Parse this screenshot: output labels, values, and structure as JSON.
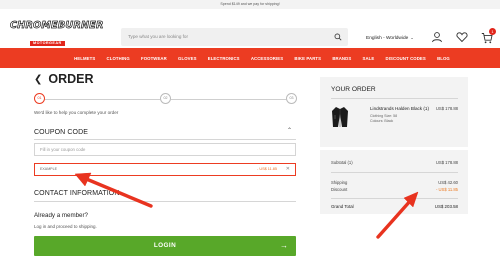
{
  "topbar": {
    "text": "Spend $149 and we pay for shipping!"
  },
  "header": {
    "logo_main": "CHROMEBURNER",
    "logo_sub": "MOTORGEAR",
    "search_placeholder": "Type what you are looking for",
    "locale": "English - Worldwide",
    "cart_count": "1",
    "icons": [
      "search-icon",
      "user-icon",
      "heart-icon",
      "cart-icon"
    ]
  },
  "nav": {
    "items": [
      "HELMETS",
      "CLOTHING",
      "FOOTWEAR",
      "GLOVES",
      "ELECTRONICS",
      "ACCESSORIES",
      "BIKE PARTS",
      "BRANDS",
      "SALE",
      "DISCOUNT CODES",
      "BLOG"
    ]
  },
  "checkout": {
    "title": "ORDER",
    "steps": [
      "01",
      "02",
      "03"
    ],
    "active_step": 1,
    "welcome": "We'd like to help you complete your order",
    "coupon_heading": "COUPON CODE",
    "coupon_placeholder": "Fill in your coupon code",
    "applied_code": "EXAMPLE",
    "applied_amount": "- US$ 11.85",
    "contact_heading": "CONTACT INFORMATION",
    "member_question": "Already a member?",
    "member_sub": "Log in and proceed to shipping.",
    "login_label": "LOGIN"
  },
  "summary": {
    "heading": "YOUR ORDER",
    "product": {
      "name": "Lindstrands Halden Black (1)",
      "price": "US$ 178.88",
      "size": "Clothing Size: 58",
      "color": "Colours: Black"
    },
    "subtotal_label": "Subtotal (1)",
    "subtotal_value": "US$ 178.88",
    "shipping_label": "Shipping",
    "shipping_value": "US$ 42.60",
    "discount_label": "Discount",
    "discount_value": "- US$ 11.85",
    "grand_label": "Grand Total",
    "grand_value": "US$ 203.58"
  },
  "colors": {
    "brand_red": "#ec3c22",
    "login_green": "#58a829",
    "discount_orange": "#ec7a22",
    "annotation_red": "#e8331f"
  }
}
